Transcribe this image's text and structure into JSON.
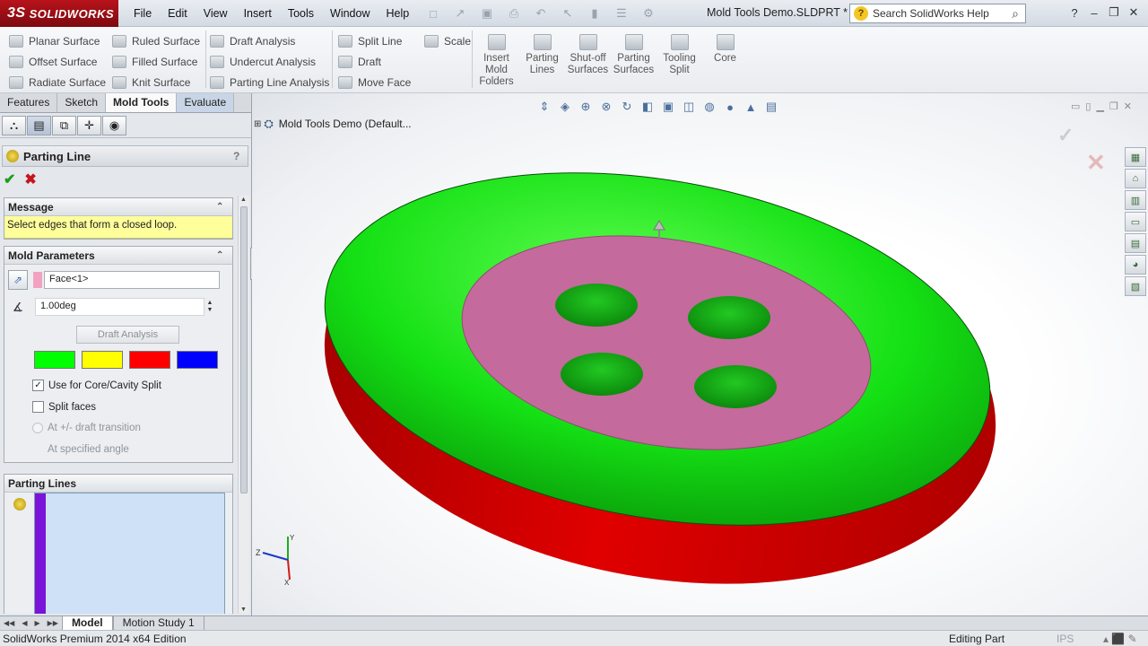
{
  "app": {
    "logo": "SOLIDWORKS",
    "logo_mark": "3S",
    "doc_title": "Mold Tools Demo.SLDPRT *"
  },
  "menu": [
    "File",
    "Edit",
    "View",
    "Insert",
    "Tools",
    "Window",
    "Help"
  ],
  "help_search": {
    "placeholder": "Search SolidWorks Help"
  },
  "toolbar": {
    "col1": [
      "Planar Surface",
      "Offset Surface",
      "Radiate Surface"
    ],
    "col2": [
      "Ruled Surface",
      "Filled Surface",
      "Knit Surface"
    ],
    "col3": [
      "Draft Analysis",
      "Undercut Analysis",
      "Parting Line Analysis"
    ],
    "col4": [
      "Split Line",
      "Draft",
      "Move Face"
    ],
    "col5": [
      "Scale"
    ],
    "big": [
      "Insert Mold Folders",
      "Parting Lines",
      "Shut-off Surfaces",
      "Parting Surfaces",
      "Tooling Split",
      "Core"
    ]
  },
  "tabs": [
    "Features",
    "Sketch",
    "Mold Tools",
    "Evaluate"
  ],
  "property_manager": {
    "title": "Parting Line",
    "help": "?",
    "message_header": "Message",
    "message": "Select edges that form a closed loop.",
    "mold_params_header": "Mold Parameters",
    "direction_face": "Face<1>",
    "draft_angle": "1.00deg",
    "draft_analysis_btn": "Draft Analysis",
    "analysis_colors": [
      "#00ff00",
      "#ffff00",
      "#ff0000",
      "#0000ff"
    ],
    "use_core_cavity": "Use for Core/Cavity Split",
    "use_core_cavity_checked": true,
    "split_faces": "Split faces",
    "split_faces_checked": false,
    "at_transition": "At +/- draft transition",
    "at_angle": "At specified angle",
    "parting_lines_header": "Parting Lines"
  },
  "graphics": {
    "tree_root": "Mold Tools Demo  (Default...",
    "model_colors": {
      "rim_top": "#00e600",
      "rim_side": "#e60000",
      "center": "#c46a9c"
    }
  },
  "bottom_tabs": [
    "Model",
    "Motion Study 1"
  ],
  "status": {
    "edition": "SolidWorks Premium 2014 x64 Edition",
    "mode": "Editing Part",
    "units": "IPS"
  }
}
